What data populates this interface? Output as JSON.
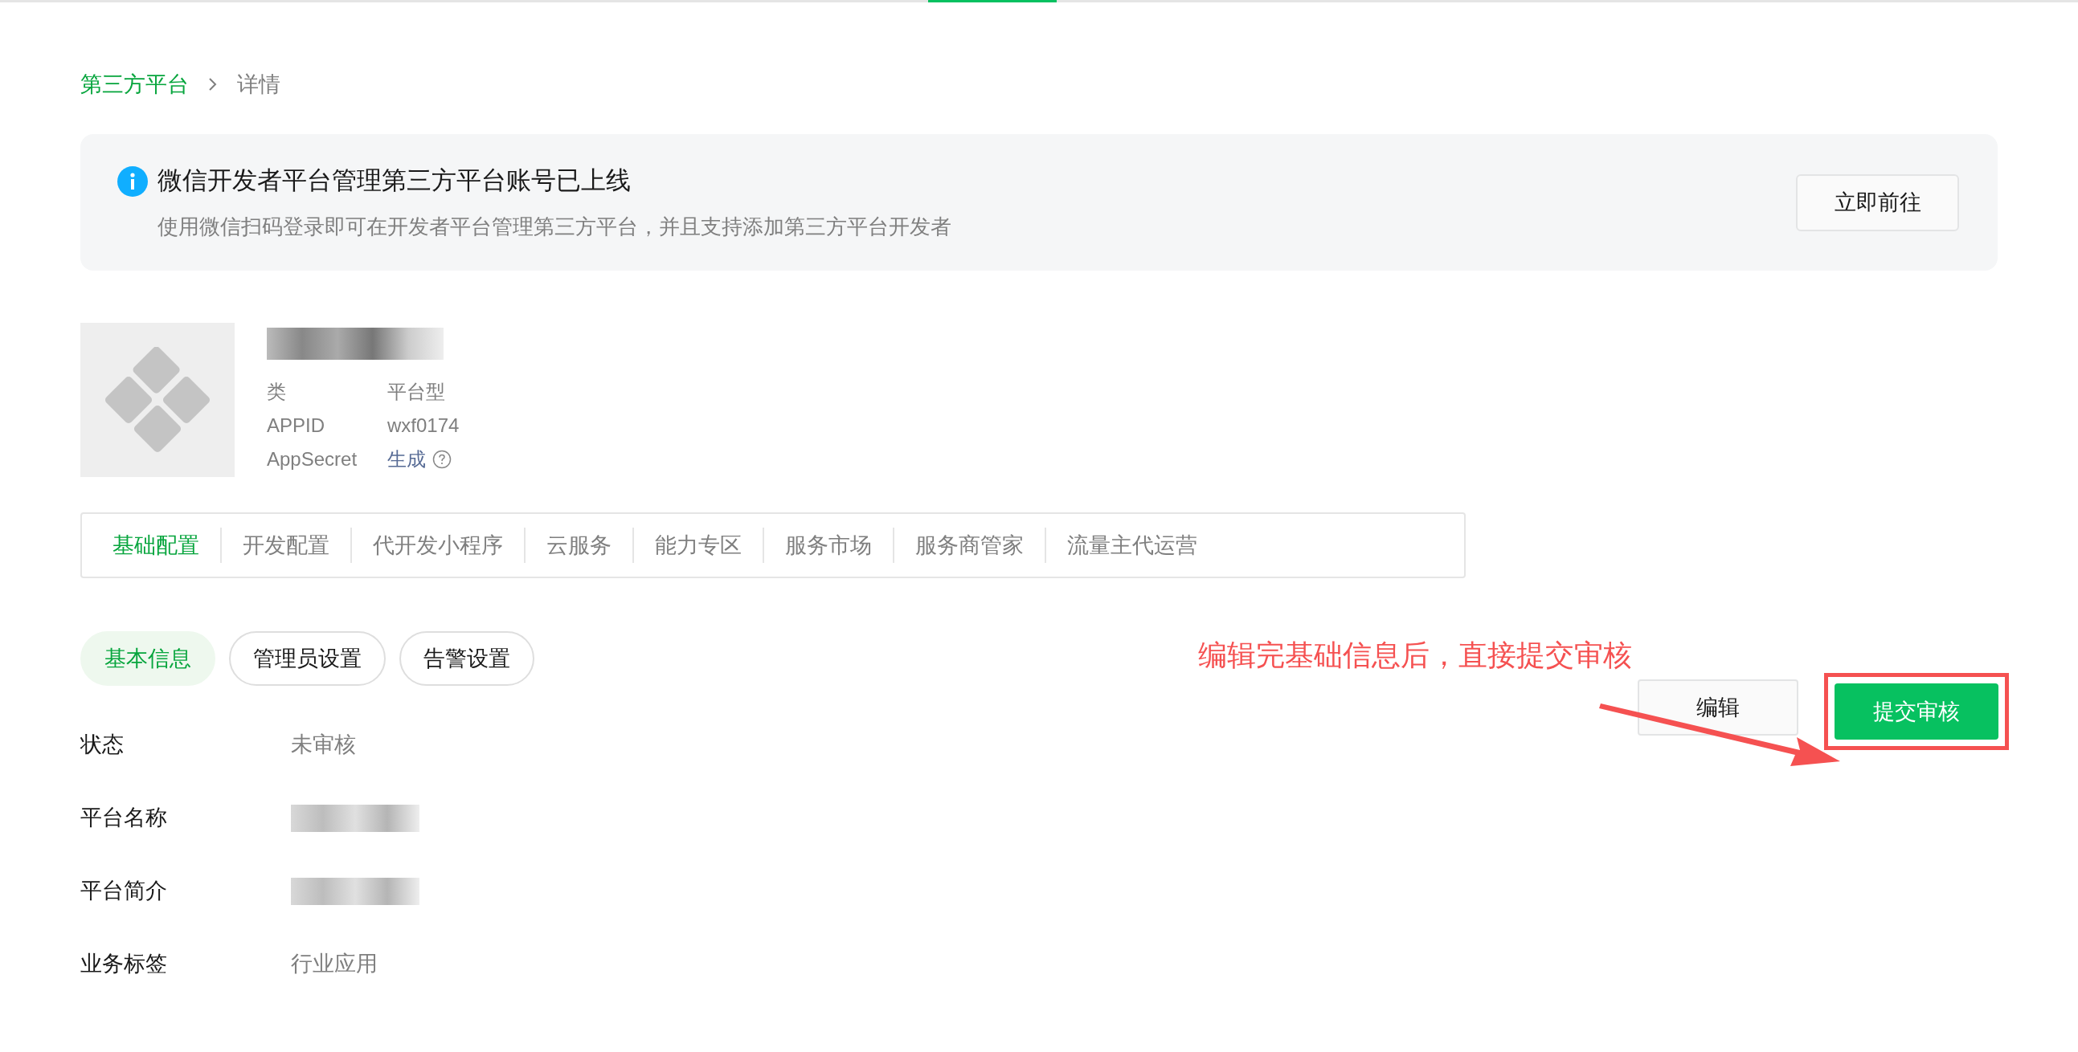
{
  "breadcrumb": [
    {
      "label": "第三方平台",
      "kind": "link"
    },
    {
      "label": "详情",
      "kind": "current"
    }
  ],
  "notice": {
    "title": "微信开发者平台管理第三方平台账号已上线",
    "description": "使用微信扫码登录即可在开发者平台管理第三方平台，并且支持添加第三方平台开发者",
    "button": "立即前往"
  },
  "profile": {
    "rows": [
      {
        "label": "类",
        "value": "平台型",
        "kind": "text"
      },
      {
        "label": "APPID",
        "value": "wxf0174",
        "kind": "text"
      },
      {
        "label": "AppSecret",
        "value": "生成",
        "kind": "action"
      }
    ]
  },
  "tabs": [
    {
      "label": "基础配置",
      "selected": true
    },
    {
      "label": "开发配置",
      "selected": false
    },
    {
      "label": "代开发小程序",
      "selected": false
    },
    {
      "label": "云服务",
      "selected": false
    },
    {
      "label": "能力专区",
      "selected": false
    },
    {
      "label": "服务市场",
      "selected": false
    },
    {
      "label": "服务商管家",
      "selected": false
    },
    {
      "label": "流量主代运营",
      "selected": false
    }
  ],
  "subtabs": [
    {
      "label": "基本信息",
      "selected": true
    },
    {
      "label": "管理员设置",
      "selected": false
    },
    {
      "label": "告警设置",
      "selected": false
    }
  ],
  "fields": [
    {
      "label": "状态",
      "value": "未审核",
      "kind": "text"
    },
    {
      "label": "平台名称",
      "kind": "redacted"
    },
    {
      "label": "平台简介",
      "kind": "redacted"
    },
    {
      "label": "业务标签",
      "value": "行业应用",
      "kind": "text"
    }
  ],
  "actions": [
    {
      "label": "编辑",
      "kind": "secondary"
    },
    {
      "label": "提交审核",
      "kind": "primary"
    }
  ],
  "annotation": "编辑完基础信息后，直接提交审核"
}
